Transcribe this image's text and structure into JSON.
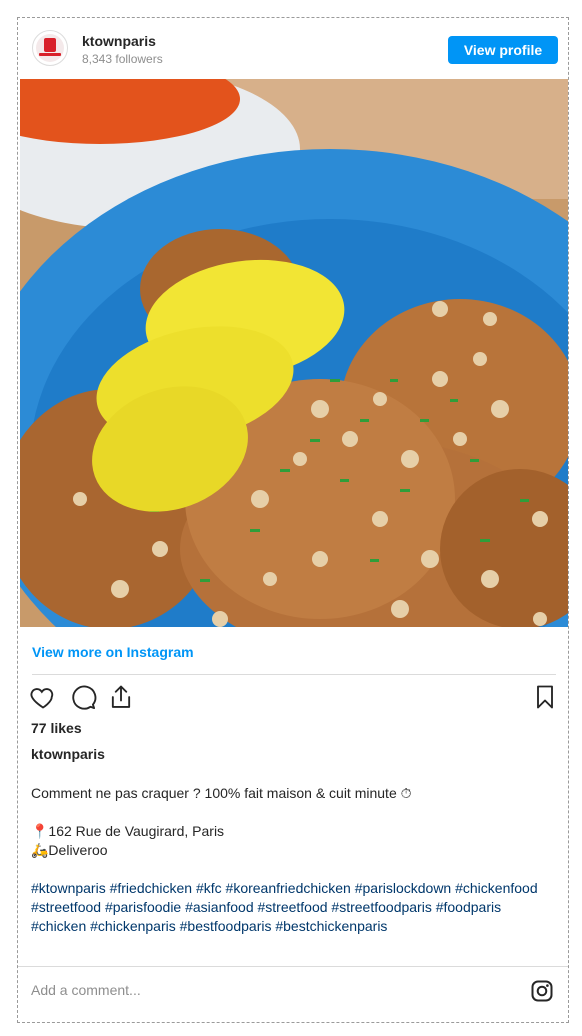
{
  "account": {
    "username": "ktownparis",
    "followers": "8,343 followers",
    "view_profile_label": "View profile"
  },
  "post": {
    "image_description_icon": "fried-chicken-photo",
    "view_more_label": "View more on Instagram",
    "likes": "77 likes",
    "caption_user": "ktownparis",
    "caption_line1": "Comment ne pas craquer ? 100% fait maison & cuit minute ⏱",
    "caption_line2": "📍162 Rue de Vaugirard, Paris",
    "caption_line3": "🛵Deliveroo",
    "hashtags": "#ktownparis #friedchicken #kfc #koreanfriedchicken #parislockdown #chickenfood #streetfood #parisfoodie #asianfood #streetfood #streetfoodparis #foodparis #chicken #chickenparis #bestfoodparis #bestchickenparis"
  },
  "actions": {
    "like_icon": "heart-icon",
    "comment_icon": "comment-icon",
    "share_icon": "share-icon",
    "save_icon": "bookmark-icon"
  },
  "comment": {
    "placeholder": "Add a comment..."
  },
  "colors": {
    "accent": "#0095f6",
    "hashtag": "#00376b",
    "plate": "#2c8bd6"
  }
}
